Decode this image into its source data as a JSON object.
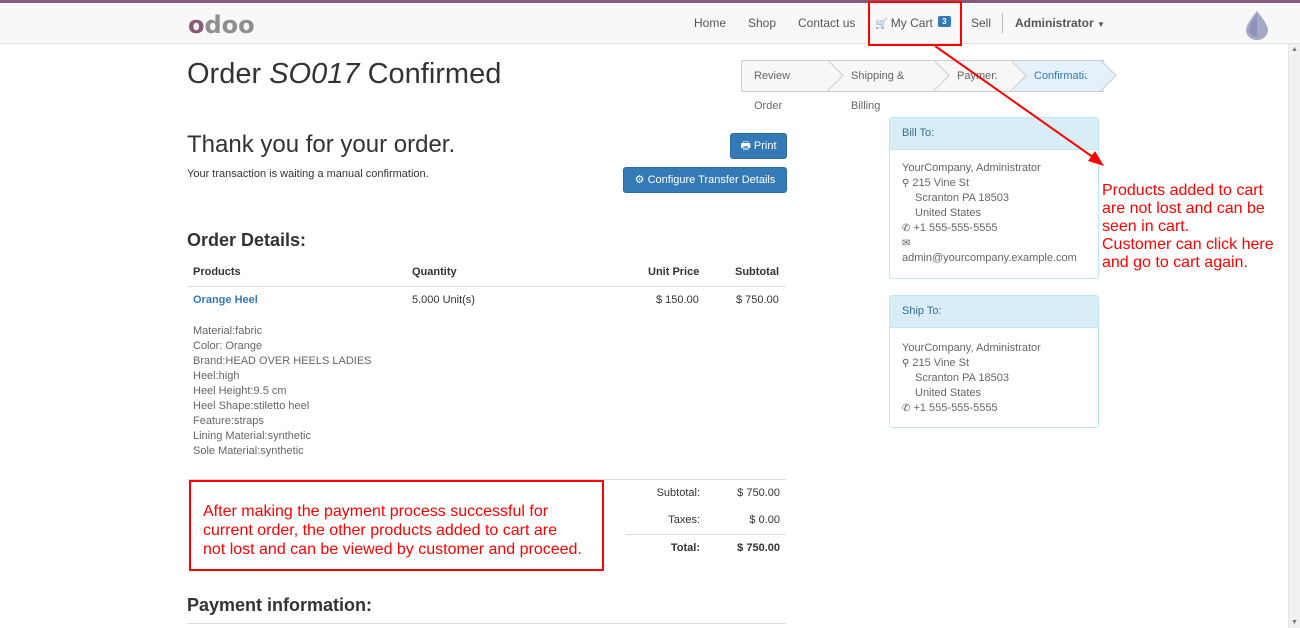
{
  "nav": {
    "logo": "odoo",
    "links": [
      "Home",
      "Shop",
      "Contact us"
    ],
    "cart_label": "My Cart",
    "cart_count": "3",
    "sell": "Sell",
    "user": "Administrator"
  },
  "page": {
    "title_prefix": "Order",
    "order_id": "SO017",
    "title_suffix": "Confirmed"
  },
  "wizard": [
    "Review Order",
    "Shipping & Billing",
    "Payment",
    "Confirmation"
  ],
  "thanks": {
    "heading": "Thank you for your order.",
    "status": "Your transaction is waiting a manual confirmation.",
    "print_label": "Print",
    "configure_label": "Configure Transfer Details"
  },
  "order": {
    "heading": "Order Details:",
    "columns": [
      "Products",
      "Quantity",
      "Unit Price",
      "Subtotal"
    ],
    "line": {
      "product": "Orange Heel",
      "quantity": "5.000 Unit(s)",
      "unit_price": "$ 150.00",
      "subtotal": "$ 750.00",
      "attributes": [
        "Material:fabric",
        "Color: Orange",
        "Brand:HEAD OVER HEELS LADIES",
        "Heel:high",
        "Heel Height:9.5 cm",
        "Heel Shape:stiletto heel",
        "Feature:straps",
        "Lining Material:synthetic",
        "Sole Material:synthetic"
      ]
    },
    "totals": {
      "subtotal_label": "Subtotal:",
      "subtotal": "$ 750.00",
      "taxes_label": "Taxes:",
      "taxes": "$ 0.00",
      "total_label": "Total:",
      "total": "$ 750.00"
    }
  },
  "payment": {
    "heading": "Payment information:"
  },
  "bill_to": {
    "title": "Bill To:",
    "name": "YourCompany, Administrator",
    "street": "215 Vine St",
    "city": "Scranton PA 18503",
    "country": "United States",
    "phone": "+1 555-555-5555",
    "email": "admin@yourcompany.example.com"
  },
  "ship_to": {
    "title": "Ship To:",
    "name": "YourCompany, Administrator",
    "street": "215 Vine St",
    "city": "Scranton PA 18503",
    "country": "United States",
    "phone": "+1 555-555-5555"
  },
  "annotations": {
    "cart_note": [
      "Products added to cart",
      "are not lost and can be",
      "seen in cart.",
      "Customer can click here",
      "and go to cart again."
    ],
    "payment_note": [
      "After making the payment process successful for",
      "current order, the other products added to cart are",
      "not lost and can be viewed by customer and proceed."
    ]
  },
  "colors": {
    "brand": "#875a7b",
    "primary": "#337ab7",
    "annotation": "#ff0000",
    "panel_header": "#d9edf7"
  }
}
